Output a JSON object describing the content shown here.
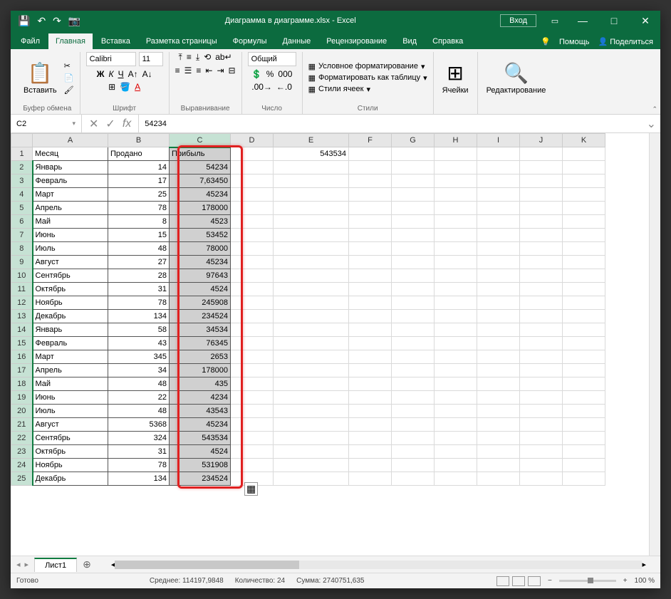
{
  "title": "Диаграмма в диаграмме.xlsx - Excel",
  "login": "Вход",
  "tabs": [
    "Файл",
    "Главная",
    "Вставка",
    "Разметка страницы",
    "Формулы",
    "Данные",
    "Рецензирование",
    "Вид",
    "Справка"
  ],
  "activeTab": 1,
  "help": "Помощь",
  "share": "Поделиться",
  "ribbon": {
    "clipboard": {
      "paste": "Вставить",
      "label": "Буфер обмена"
    },
    "font": {
      "name": "Calibri",
      "size": "11",
      "label": "Шрифт"
    },
    "align": {
      "label": "Выравнивание"
    },
    "number": {
      "format": "Общий",
      "label": "Число"
    },
    "styles": {
      "cond": "Условное форматирование",
      "table": "Форматировать как таблицу",
      "cell": "Стили ячеек",
      "label": "Стили"
    },
    "cells": {
      "label": "Ячейки"
    },
    "editing": {
      "label": "Редактирование"
    }
  },
  "nameBox": "C2",
  "formulaValue": "54234",
  "columns": [
    "A",
    "B",
    "C",
    "D",
    "E",
    "F",
    "G",
    "H",
    "I",
    "J",
    "K"
  ],
  "headers": {
    "A": "Месяц",
    "B": "Продано",
    "C": "Прибыль"
  },
  "e1": "543534",
  "rows": [
    {
      "n": 2,
      "a": "Январь",
      "b": "14",
      "c": "54234"
    },
    {
      "n": 3,
      "a": "Февраль",
      "b": "17",
      "c": "7,63450"
    },
    {
      "n": 4,
      "a": "Март",
      "b": "25",
      "c": "45234"
    },
    {
      "n": 5,
      "a": "Апрель",
      "b": "78",
      "c": "178000"
    },
    {
      "n": 6,
      "a": "Май",
      "b": "8",
      "c": "4523"
    },
    {
      "n": 7,
      "a": "Июнь",
      "b": "15",
      "c": "53452"
    },
    {
      "n": 8,
      "a": "Июль",
      "b": "48",
      "c": "78000"
    },
    {
      "n": 9,
      "a": "Август",
      "b": "27",
      "c": "45234"
    },
    {
      "n": 10,
      "a": "Сентябрь",
      "b": "28",
      "c": "97643"
    },
    {
      "n": 11,
      "a": "Октябрь",
      "b": "31",
      "c": "4524"
    },
    {
      "n": 12,
      "a": "Ноябрь",
      "b": "78",
      "c": "245908"
    },
    {
      "n": 13,
      "a": "Декабрь",
      "b": "134",
      "c": "234524"
    },
    {
      "n": 14,
      "a": "Январь",
      "b": "58",
      "c": "34534"
    },
    {
      "n": 15,
      "a": "Февраль",
      "b": "43",
      "c": "76345"
    },
    {
      "n": 16,
      "a": "Март",
      "b": "345",
      "c": "2653"
    },
    {
      "n": 17,
      "a": "Апрель",
      "b": "34",
      "c": "178000"
    },
    {
      "n": 18,
      "a": "Май",
      "b": "48",
      "c": "435"
    },
    {
      "n": 19,
      "a": "Июнь",
      "b": "22",
      "c": "4234"
    },
    {
      "n": 20,
      "a": "Июль",
      "b": "48",
      "c": "43543"
    },
    {
      "n": 21,
      "a": "Август",
      "b": "5368",
      "c": "45234"
    },
    {
      "n": 22,
      "a": "Сентябрь",
      "b": "324",
      "c": "543534"
    },
    {
      "n": 23,
      "a": "Октябрь",
      "b": "31",
      "c": "4524"
    },
    {
      "n": 24,
      "a": "Ноябрь",
      "b": "78",
      "c": "531908"
    },
    {
      "n": 25,
      "a": "Декабрь",
      "b": "134",
      "c": "234524"
    }
  ],
  "sheetName": "Лист1",
  "status": {
    "ready": "Готово",
    "avg": "Среднее: 114197,9848",
    "count": "Количество: 24",
    "sum": "Сумма: 2740751,635",
    "zoom": "100 %"
  }
}
